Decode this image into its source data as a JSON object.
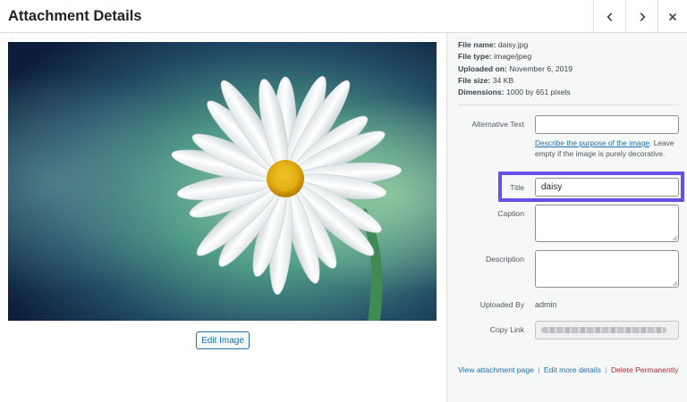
{
  "modal": {
    "title": "Attachment Details"
  },
  "file_info": {
    "name_label": "File name:",
    "name": "daisy.jpg",
    "type_label": "File type:",
    "type": "image/jpeg",
    "uploaded_label": "Uploaded on:",
    "uploaded": "November 6, 2019",
    "size_label": "File size:",
    "size": "34 KB",
    "dimensions_label": "Dimensions:",
    "dimensions": "1000 by 651 pixels"
  },
  "fields": {
    "alt_label": "Alternative Text",
    "alt_value": "",
    "alt_help_link": "Describe the purpose of the image",
    "alt_help_period": ".",
    "alt_help_text": "Leave empty if the image is purely decorative.",
    "title_label": "Title",
    "title_value": "daisy",
    "caption_label": "Caption",
    "caption_value": "",
    "description_label": "Description",
    "description_value": "",
    "uploaded_by_label": "Uploaded By",
    "uploaded_by": "admin",
    "copy_link_label": "Copy Link"
  },
  "media": {
    "edit_button": "Edit Image"
  },
  "actions": {
    "view": "View attachment page",
    "sep": "|",
    "edit": "Edit more details",
    "delete": "Delete Permanently"
  },
  "colors": {
    "accent": "#2271b1",
    "delete": "#b32d2e",
    "highlight": "#6a4ee8"
  },
  "icons": {
    "prev": "chevron-left-icon",
    "next": "chevron-right-icon",
    "close": "close-icon"
  }
}
